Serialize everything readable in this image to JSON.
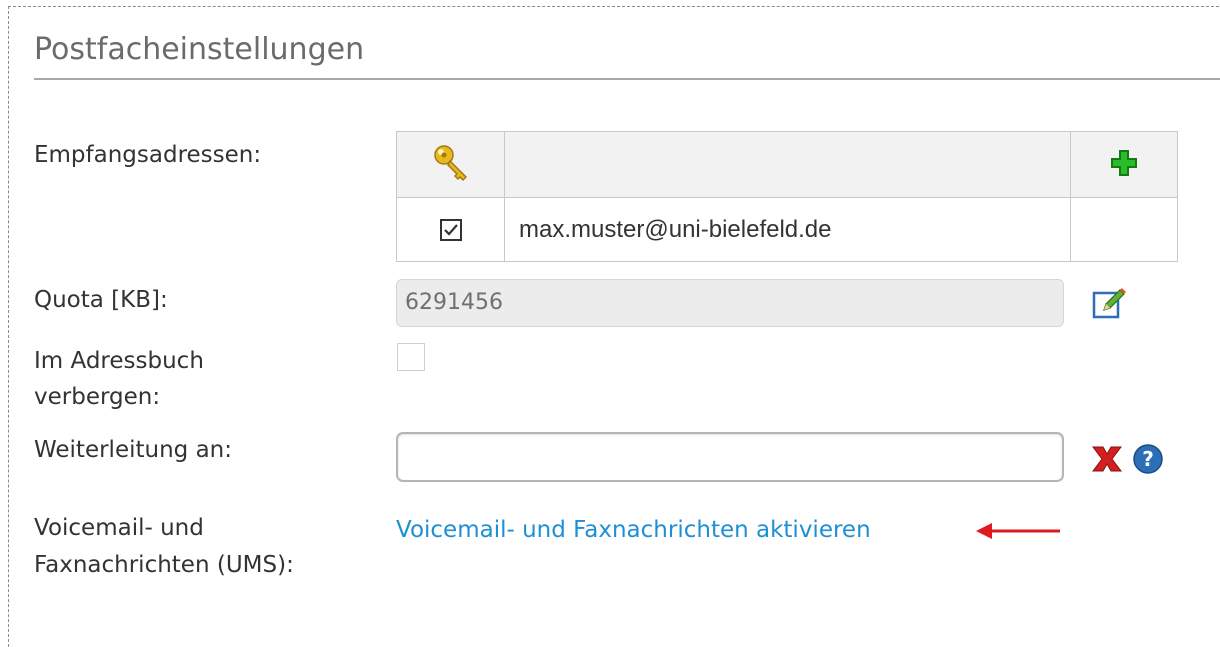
{
  "section": {
    "title": "Postfacheinstellungen"
  },
  "labels": {
    "addresses": "Empfangsadressen:",
    "quota": "Quota [KB]:",
    "hide_line1": "Im Adressbuch",
    "hide_line2": "verbergen:",
    "forward": "Weiterleitung an:",
    "ums_line1": "Voicemail- und",
    "ums_line2": "Faxnachrichten (UMS):"
  },
  "addresses": {
    "header_icons": {
      "primary": "key-icon",
      "add": "plus-icon"
    },
    "rows": [
      {
        "primary": true,
        "address": "max.muster@uni-bielefeld.de"
      }
    ]
  },
  "quota": {
    "value": "6291456",
    "edit_icon": "edit-icon"
  },
  "hide_in_addressbook": {
    "checked": false
  },
  "forward": {
    "value": "",
    "clear_icon": "close-icon",
    "help_icon": "help-icon"
  },
  "ums": {
    "link_text": "Voicemail- und Faxnachrichten aktivieren",
    "arrow_icon": "arrow-left-icon"
  },
  "colors": {
    "link": "#1e8fd6",
    "arrow": "#e0191f",
    "add": "#21a81f",
    "clear": "#d21f1f",
    "help": "#2d6fb7"
  }
}
